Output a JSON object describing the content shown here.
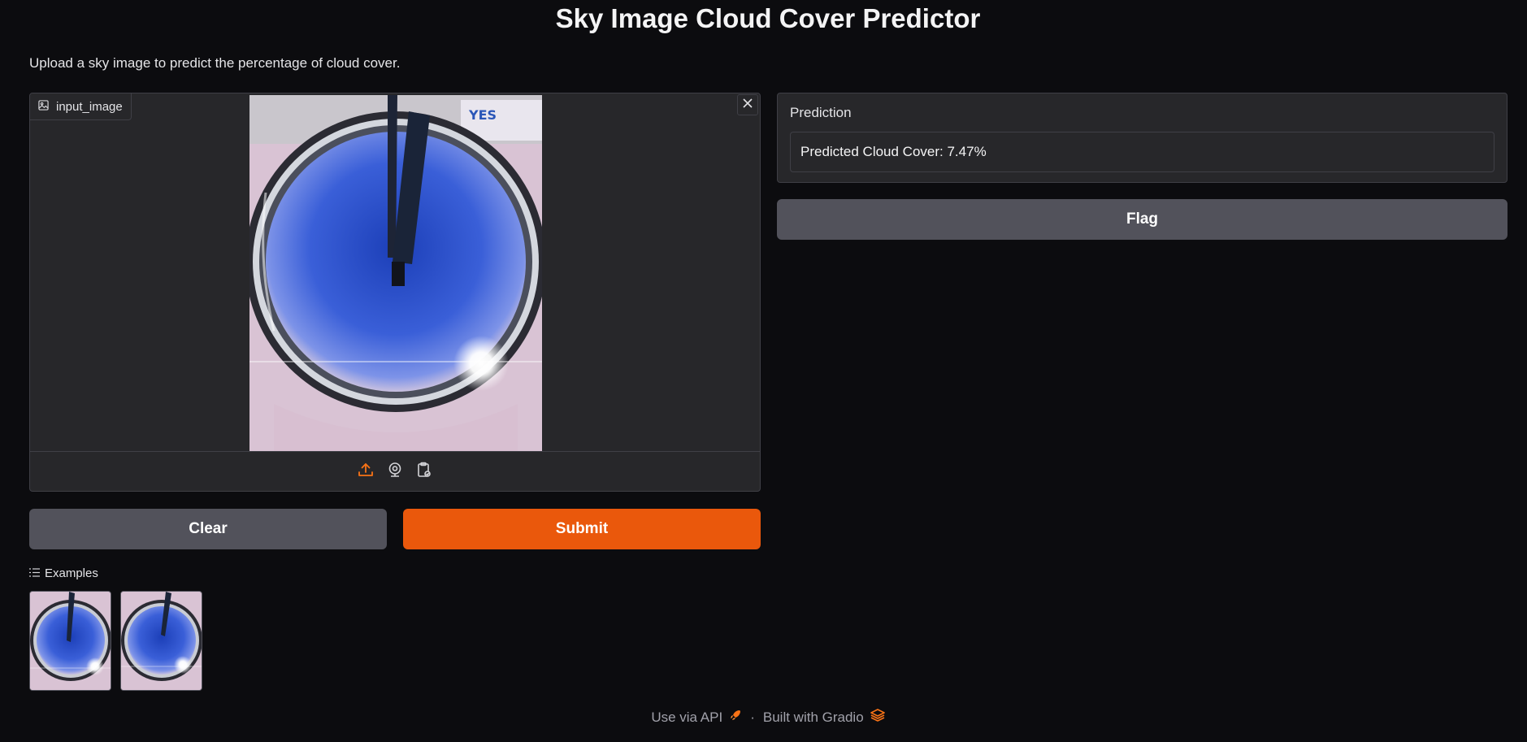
{
  "page": {
    "title": "Sky Image Cloud Cover Predictor",
    "subtitle": "Upload a sky image to predict the percentage of cloud cover."
  },
  "input_image": {
    "label": "input_image",
    "source_icons": [
      "upload-icon",
      "webcam-icon",
      "clipboard-icon"
    ]
  },
  "buttons": {
    "clear": "Clear",
    "submit": "Submit",
    "flag": "Flag"
  },
  "examples": {
    "label": "Examples",
    "count": 2
  },
  "prediction": {
    "label": "Prediction",
    "value": "Predicted Cloud Cover: 7.47%"
  },
  "footer": {
    "api": "Use via API",
    "separator": "·",
    "built": "Built with Gradio"
  },
  "colors": {
    "background": "#0c0c0f",
    "panel": "#27272a",
    "accent": "#ea580c",
    "secondary_button": "#52525b"
  }
}
